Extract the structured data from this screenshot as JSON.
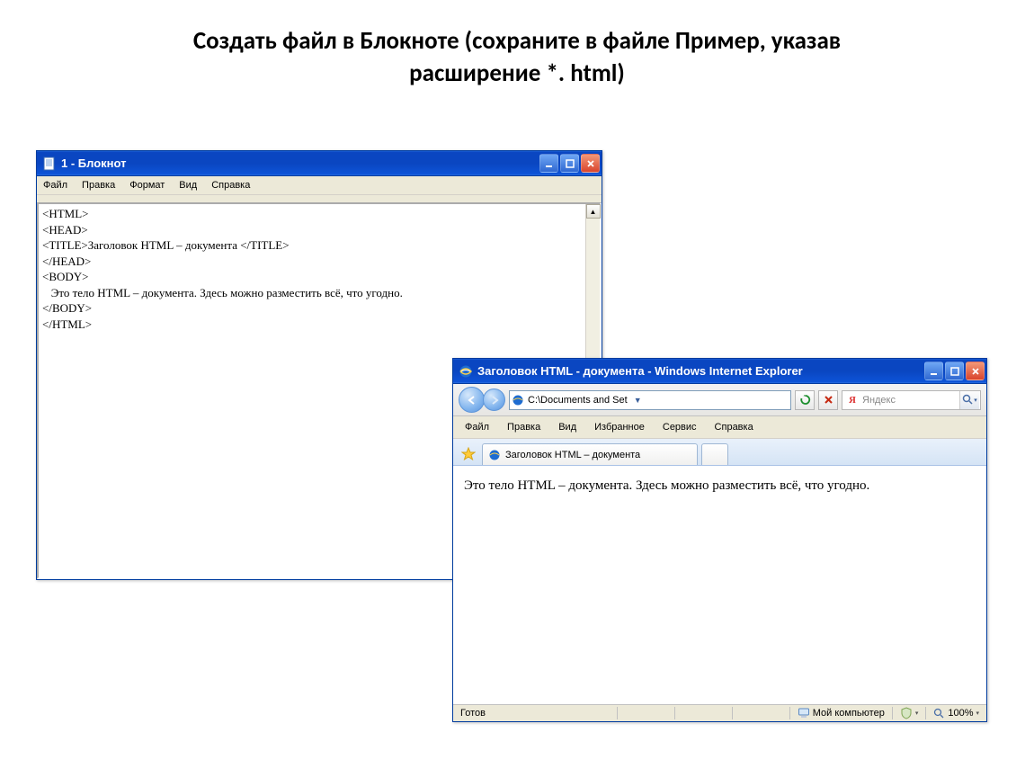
{
  "page_heading_line1": "Создать файл в Блокноте (сохраните в файле  Пример,  указав",
  "page_heading_line2": "расширение  *. html)",
  "notepad": {
    "title": "1 - Блокнот",
    "menu": [
      "Файл",
      "Правка",
      "Формат",
      "Вид",
      "Справка"
    ],
    "lines": [
      "<HTML>",
      "<HEAD>",
      "<TITLE>Заголовок HTML – документа </TITLE>",
      "</HEAD>",
      "<BODY>",
      "   Это тело HTML – документа. Здесь можно разместить всё, что угодно.",
      "</BODY>",
      "</HTML>"
    ]
  },
  "ie": {
    "title": "Заголовок HTML - документа - Windows Internet Explorer",
    "address": "C:\\Documents and Set",
    "search_engine_hint": "Яндекс",
    "menu": [
      "Файл",
      "Правка",
      "Вид",
      "Избранное",
      "Сервис",
      "Справка"
    ],
    "tab_label": "Заголовок HTML – документа",
    "body_text": "Это тело HTML – документа. Здесь можно разместить всё, что угодно.",
    "status_ready": "Готов",
    "status_zone": "Мой компьютер",
    "zoom": "100%"
  }
}
